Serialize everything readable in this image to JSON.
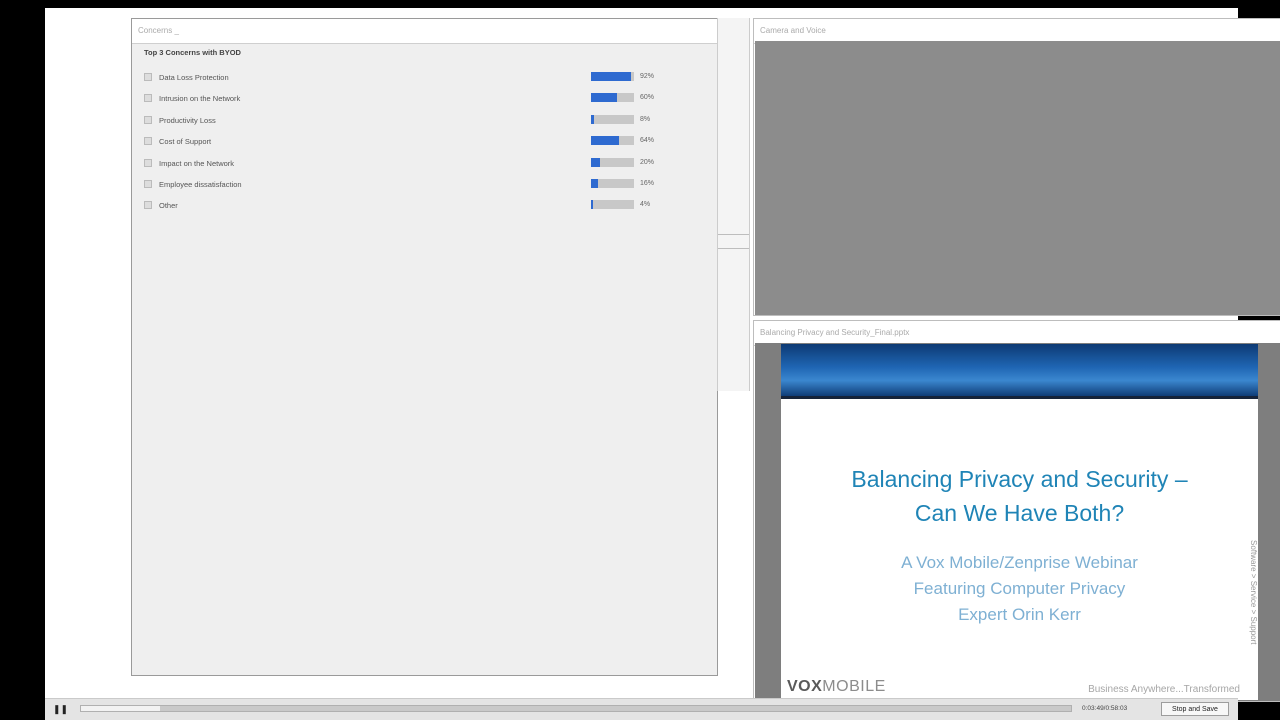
{
  "poll_pod": {
    "title": "Concerns _",
    "question": "Top 3 Concerns with BYOD",
    "options": [
      {
        "label": "Data Loss Protection",
        "percent_label": "92%",
        "fraction": 0.92
      },
      {
        "label": "Intrusion on the Network",
        "percent_label": "60%",
        "fraction": 0.6
      },
      {
        "label": "Productivity Loss",
        "percent_label": "8%",
        "fraction": 0.08
      },
      {
        "label": "Cost of Support",
        "percent_label": "64%",
        "fraction": 0.64
      },
      {
        "label": "Impact on the Network",
        "percent_label": "20%",
        "fraction": 0.2
      },
      {
        "label": "Employee dissatisfaction",
        "percent_label": "16%",
        "fraction": 0.16
      },
      {
        "label": "Other",
        "percent_label": "4%",
        "fraction": 0.04
      }
    ],
    "bar_color": "#2e6ad0"
  },
  "camera_pod": {
    "title": "Camera and Voice"
  },
  "share_pod": {
    "title": "Balancing Privacy and Security_Final.pptx",
    "slide": {
      "title_line1": "Balancing Privacy and Security –",
      "title_line2": "Can We Have Both?",
      "sub_line1": "A Vox Mobile/Zenprise Webinar",
      "sub_line2": "Featuring Computer Privacy",
      "sub_line3": "Expert Orin Kerr",
      "logo_bold": "VOX",
      "logo_light": "MOBILE",
      "tagline": "Business Anywhere...Transformed",
      "vertical_text": "Software > Service > Support"
    }
  },
  "playback": {
    "pause_icon": "pause-icon",
    "pause_glyph": "❚❚",
    "progress_fraction": 0.08,
    "timecode": "0:03:49/0:58:03",
    "stop_label": "Stop and Save"
  }
}
